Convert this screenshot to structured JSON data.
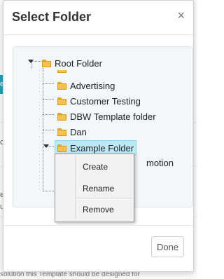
{
  "dialog": {
    "title": "Select Folder",
    "close_label": "×",
    "done_label": "Done"
  },
  "tree": {
    "root": "Root Folder",
    "children": [
      "Advertising",
      "Customer Testing",
      "DBW Template folder",
      "Dan",
      "Example Folder"
    ],
    "partial_hidden_child": "motion",
    "selected": "Example Folder"
  },
  "context_menu": {
    "items": [
      "Create",
      "Rename",
      "Remove"
    ]
  },
  "background": {
    "left_tab_text": "e",
    "left_frag_1": "ct",
    "left_frag_2": "e",
    "left_frag_3": "u",
    "right_frag": "e f",
    "bottom_text": "solution this Template should be designed for"
  },
  "colors": {
    "selection": "#bde9f7",
    "folder": "#f2c14e",
    "accent_tab": "#1aa6b7"
  }
}
